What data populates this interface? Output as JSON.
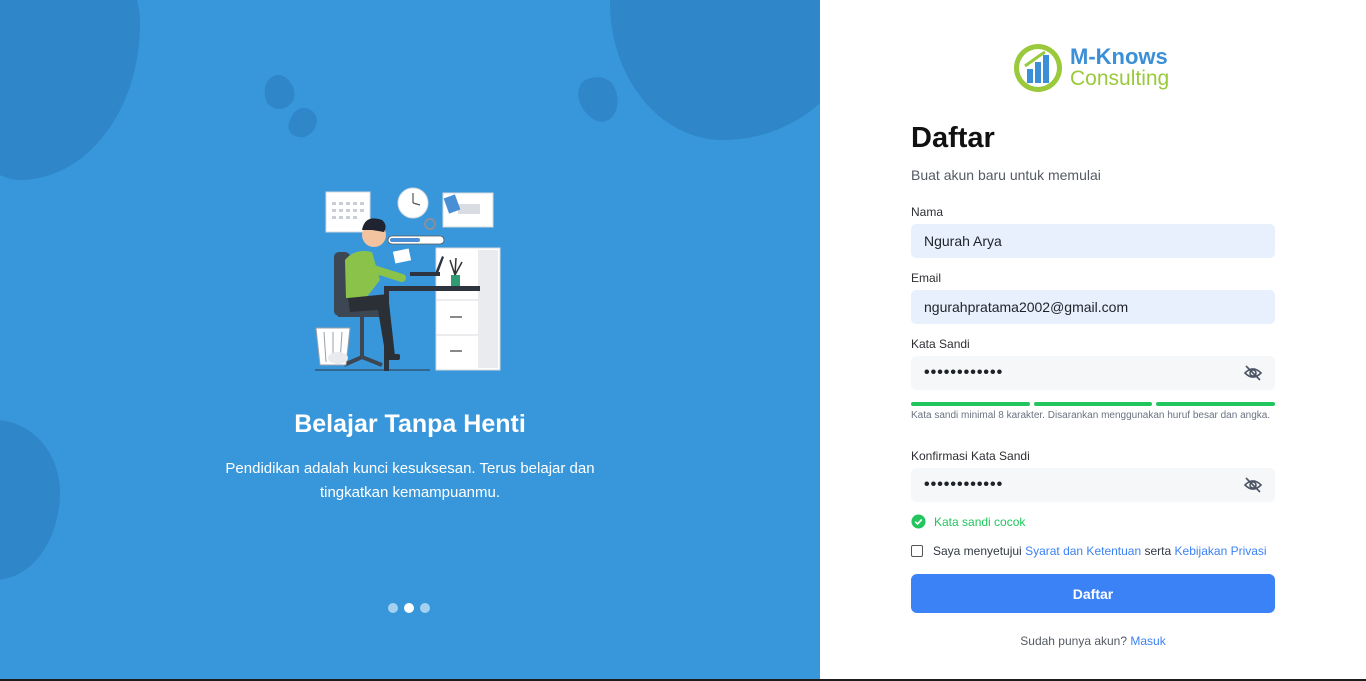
{
  "hero": {
    "title": "Belajar Tanpa Henti",
    "subtitle": "Pendidikan adalah kunci kesuksesan. Terus belajar dan tingkatkan kemampuanmu.",
    "slides": {
      "count": 3,
      "active": 2
    }
  },
  "brand": {
    "name_line1": "M-Knows",
    "name_line2": "Consulting",
    "colors": {
      "primary": "#3b8fd6",
      "accent": "#9ac93b"
    }
  },
  "form": {
    "title": "Daftar",
    "subtitle": "Buat akun baru untuk memulai",
    "name_label": "Nama",
    "name_value": "Ngurah Arya",
    "email_label": "Email",
    "email_value": "ngurahpratama2002@gmail.com",
    "password_label": "Kata Sandi",
    "password_masked": "••••••••••••",
    "password_hint": "Kata sandi minimal 8 karakter. Disarankan menggunakan huruf besar dan angka.",
    "confirm_label": "Konfirmasi Kata Sandi",
    "confirm_masked": "••••••••••••",
    "match_text": "Kata sandi cocok",
    "agree_prefix": "Saya menyetujui",
    "terms_link": "Syarat dan Ketentuan",
    "agree_middle": "serta",
    "privacy_link": "Kebijakan Privasi",
    "submit_label": "Daftar",
    "login_prompt": "Sudah punya akun?",
    "login_link": "Masuk"
  },
  "colors": {
    "hero_bg": "#3897db",
    "primary_button": "#3b82f6",
    "success": "#22c55e",
    "input_filled": "#e8f0fe"
  },
  "icons": {
    "password_toggle": "eye-off-icon",
    "match": "check-circle-icon"
  }
}
